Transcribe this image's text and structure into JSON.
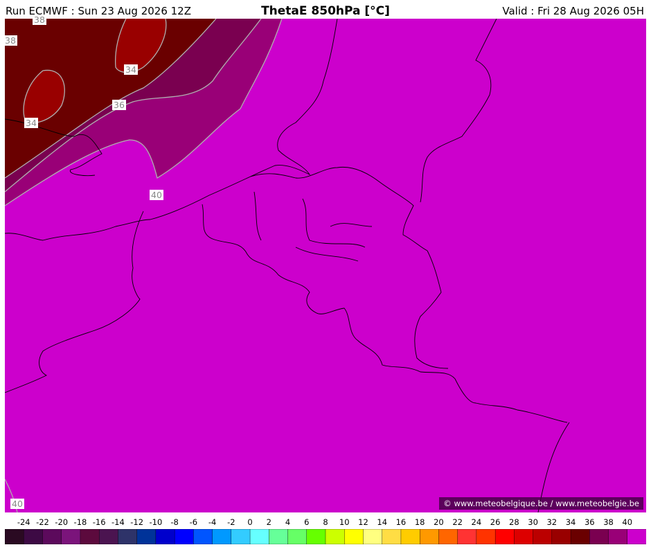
{
  "header": {
    "run": "Run ECMWF : Sun 23 Aug 2026 12Z",
    "title": "ThetaE 850hPa [°C]",
    "valid": "Valid : Fri 28 Aug 2026 05H"
  },
  "credit": "© www.meteobelgique.be / www.meteobelgie.be",
  "contour_labels": [
    "38",
    "38",
    "34",
    "36",
    "34",
    "40",
    "40"
  ],
  "colorbar": {
    "ticks": [
      "-24",
      "-22",
      "-20",
      "-18",
      "-16",
      "-14",
      "-12",
      "-10",
      "-8",
      "-6",
      "-4",
      "-2",
      "0",
      "2",
      "4",
      "6",
      "8",
      "10",
      "12",
      "14",
      "16",
      "18",
      "20",
      "22",
      "24",
      "26",
      "28",
      "30",
      "32",
      "34",
      "36",
      "38",
      "40"
    ],
    "colors": [
      "#2a0a22",
      "#3d0a44",
      "#5c0a5c",
      "#7b147b",
      "#5c0a3d",
      "#4b1450",
      "#2e3369",
      "#003399",
      "#0000cc",
      "#0000ff",
      "#0055ff",
      "#0099ff",
      "#33ccff",
      "#66ffff",
      "#66ff99",
      "#66ff66",
      "#66ff00",
      "#ccff00",
      "#ffff00",
      "#ffff80",
      "#ffdd44",
      "#ffcc00",
      "#ff9900",
      "#ff6600",
      "#ff3333",
      "#ff3300",
      "#ff0000",
      "#dd0000",
      "#bb0000",
      "#990000",
      "#6a0000",
      "#7a0050",
      "#990077",
      "#cc00cc"
    ]
  },
  "colors": {
    "base": "#cc00cc",
    "band_38": "#990077",
    "band_36": "#7a0050",
    "band_34": "#6a0000",
    "band_32": "#990000"
  }
}
